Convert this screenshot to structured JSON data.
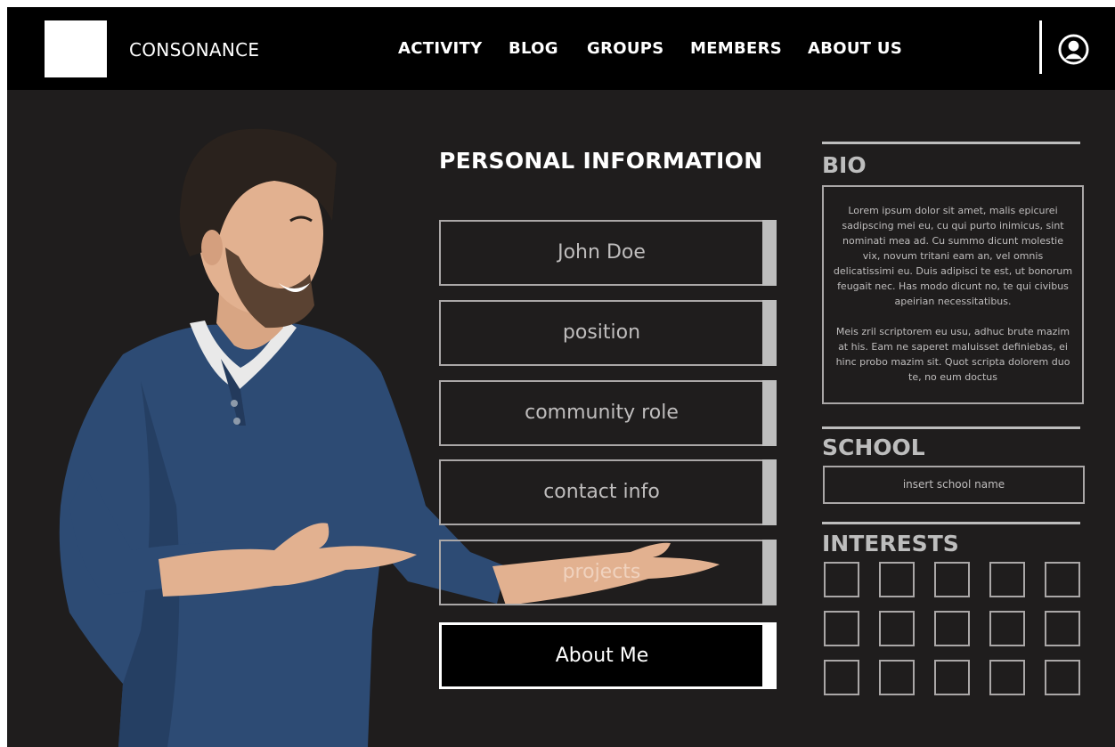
{
  "header": {
    "brand": "CONSONANCE",
    "nav": [
      "ACTIVITY",
      "BLOG",
      "GROUPS",
      "MEMBERS",
      "ABOUT US"
    ],
    "user_icon": "user-icon"
  },
  "personal_info": {
    "heading": "PERSONAL INFORMATION",
    "fields": [
      "John Doe",
      "position",
      "community role",
      "contact info",
      "projects"
    ],
    "about_button": "About Me"
  },
  "bio": {
    "heading": "BIO",
    "paragraphs": [
      "Lorem ipsum dolor sit amet, malis epicurei sadipscing mei eu, cu qui purto inimicus, sint nominati mea ad. Cu summo dicunt molestie vix, novum tritani eam an, vel omnis delicatissimi eu. Duis adipisci te est, ut bonorum feugait nec. Has modo dicunt no, te qui civibus apeirian necessitatibus.",
      "Meis zril scriptorem eu usu, adhuc brute mazim at his. Eam ne saperet maluisset definiebas, ei hinc probo mazim sit. Quot scripta dolorem duo te, no eum doctus"
    ]
  },
  "school": {
    "heading": "SCHOOL",
    "placeholder": "insert school name"
  },
  "interests": {
    "heading": "INTERESTS",
    "rows": 3,
    "cols": 5
  },
  "colors": {
    "background": "#1f1d1d",
    "topbar": "#000000",
    "border": "#aaa7a7",
    "muted_text": "#bfbdbd"
  }
}
